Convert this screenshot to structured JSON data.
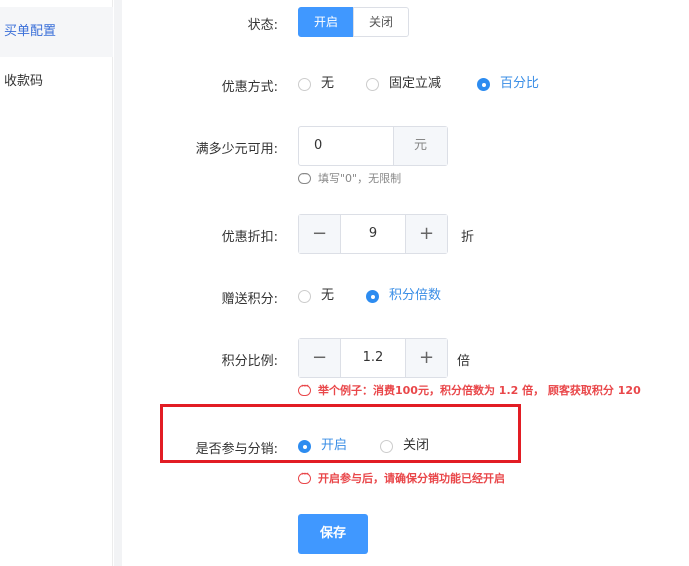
{
  "sidebar": {
    "items": [
      {
        "label": "买单配置"
      },
      {
        "label": "收款码"
      }
    ]
  },
  "form": {
    "status": {
      "label": "状态:",
      "on": "开启",
      "off": "关闭"
    },
    "discount_type": {
      "label": "优惠方式:",
      "options": [
        "无",
        "固定立减",
        "百分比"
      ],
      "selected": "百分比"
    },
    "min_amount": {
      "label": "满多少元可用:",
      "value": "0",
      "suffix": "元",
      "hint": "填写\"0\"，无限制"
    },
    "discount": {
      "label": "优惠折扣:",
      "value": "9",
      "unit": "折",
      "minus": "−",
      "plus": "+"
    },
    "bonus_points": {
      "label": "赠送积分:",
      "options": [
        "无",
        "积分倍数"
      ],
      "selected": "积分倍数"
    },
    "points_ratio": {
      "label": "积分比例:",
      "value": "1.2",
      "unit": "倍",
      "minus": "−",
      "plus": "+",
      "hint": "举个例子：消费100元，积分倍数为  1.2  倍， 顾客获取积分  120"
    },
    "distribution": {
      "label": "是否参与分销:",
      "options": [
        "开启",
        "关闭"
      ],
      "selected": "开启",
      "hint": "开启参与后，请确保分销功能已经开启"
    },
    "save_label": "保存"
  },
  "colors": {
    "primary": "#4098ff",
    "danger": "#e9474a",
    "highlight_border": "#e21d24"
  }
}
